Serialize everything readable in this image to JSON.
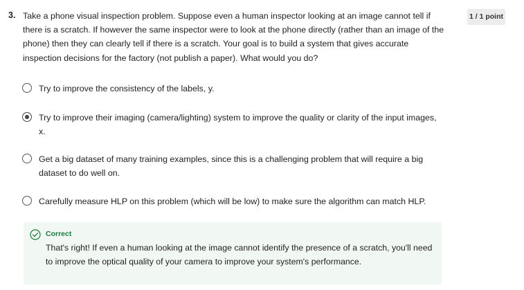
{
  "question": {
    "number": "3.",
    "text": "Take a phone visual inspection problem. Suppose even a human inspector looking at an image cannot tell if there is a scratch. If however the same inspector were to look at the phone directly (rather than an image of the phone) then they can clearly tell if there is a scratch. Your goal is to build a system that gives accurate inspection decisions for the factory (not publish a paper). What would you do?",
    "points": "1 / 1 point"
  },
  "options": [
    {
      "label": "Try to improve the consistency of the labels, y.",
      "selected": false
    },
    {
      "label": "Try to improve their imaging (camera/lighting) system to improve the quality or clarity of the input images, x.",
      "selected": true
    },
    {
      "label": "Get a big dataset of many training examples, since this is a challenging problem that will require a big dataset to do well on.",
      "selected": false
    },
    {
      "label": "Carefully measure HLP on this problem (which will be low) to make sure the algorithm can match HLP.",
      "selected": false
    }
  ],
  "feedback": {
    "icon": "check-circle-icon",
    "status": "Correct",
    "text": "That's right! If even a human looking at the image cannot identify the presence of a scratch, you'll need to improve the optical quality of your camera to improve your system's performance.",
    "color": "#1e7a3c"
  }
}
